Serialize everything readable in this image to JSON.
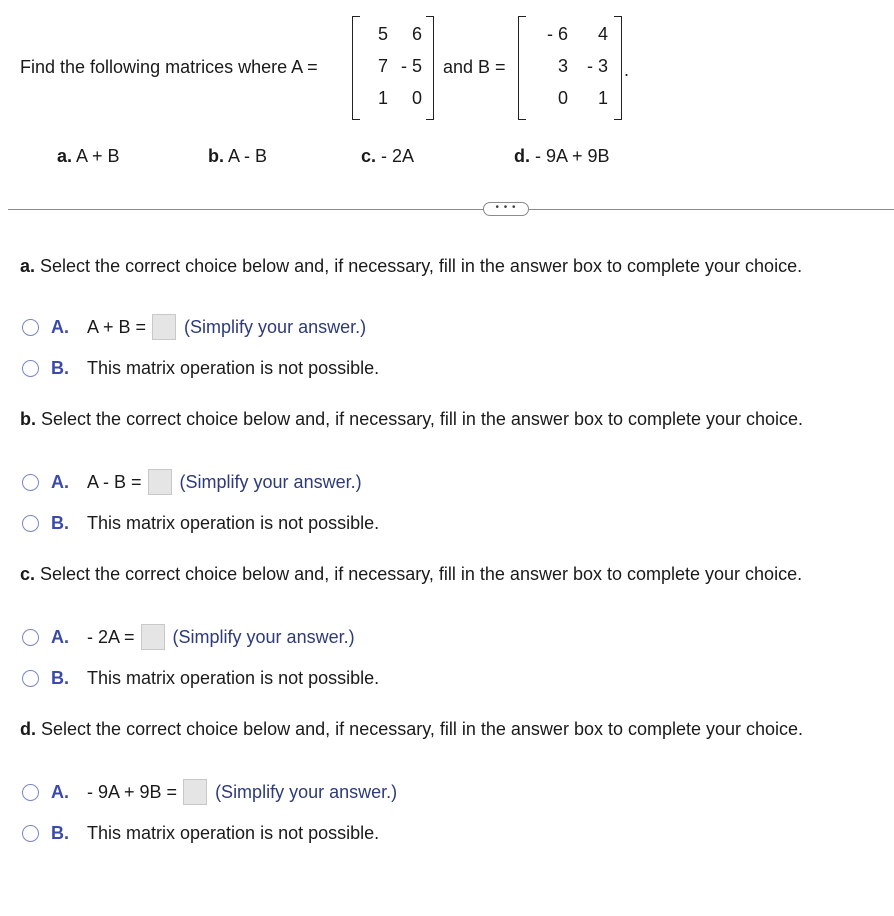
{
  "problem": {
    "intro": "Find the following matrices where A =",
    "and_b": "and B =",
    "period": ".",
    "matrix_a": [
      [
        "5",
        "6"
      ],
      [
        "7",
        "- 5"
      ],
      [
        "1",
        "0"
      ]
    ],
    "matrix_b": [
      [
        "- 6",
        "4"
      ],
      [
        "3",
        "- 3"
      ],
      [
        "0",
        "1"
      ]
    ],
    "parts": [
      {
        "letter": "a.",
        "expr": "A + B"
      },
      {
        "letter": "b.",
        "expr": "A - B"
      },
      {
        "letter": "c.",
        "expr": "- 2A"
      },
      {
        "letter": "d.",
        "expr": "- 9A + 9B"
      }
    ]
  },
  "more_button": {
    "label": "• • •"
  },
  "sections": [
    {
      "letter": "a.",
      "prompt": "Select the correct choice below and, if necessary, fill in the answer box to complete your choice.",
      "choice_a": {
        "letter": "A.",
        "expr": "A + B =",
        "answer": "",
        "hint": "(Simplify your answer.)"
      },
      "choice_b": {
        "letter": "B.",
        "text": "This matrix operation is not possible."
      }
    },
    {
      "letter": "b.",
      "prompt": "Select the correct choice below and, if necessary, fill in the answer box to complete your choice.",
      "choice_a": {
        "letter": "A.",
        "expr": "A - B =",
        "answer": "",
        "hint": "(Simplify your answer.)"
      },
      "choice_b": {
        "letter": "B.",
        "text": "This matrix operation is not possible."
      }
    },
    {
      "letter": "c.",
      "prompt": "Select the correct choice below and, if necessary, fill in the answer box to complete your choice.",
      "choice_a": {
        "letter": "A.",
        "expr": "- 2A =",
        "answer": "",
        "hint": "(Simplify your answer.)"
      },
      "choice_b": {
        "letter": "B.",
        "text": "This matrix operation is not possible."
      }
    },
    {
      "letter": "d.",
      "prompt": "Select the correct choice below and, if necessary, fill in the answer box to complete your choice.",
      "choice_a": {
        "letter": "A.",
        "expr": "- 9A + 9B =",
        "answer": "",
        "hint": "(Simplify your answer.)"
      },
      "choice_b": {
        "letter": "B.",
        "text": "This matrix operation is not possible."
      }
    }
  ],
  "colors": {
    "choice_letter": "#3b4aa8",
    "radio_border": "#7b86c4",
    "hint": "#2e3a7a",
    "answer_box": "#e5e5e5"
  }
}
